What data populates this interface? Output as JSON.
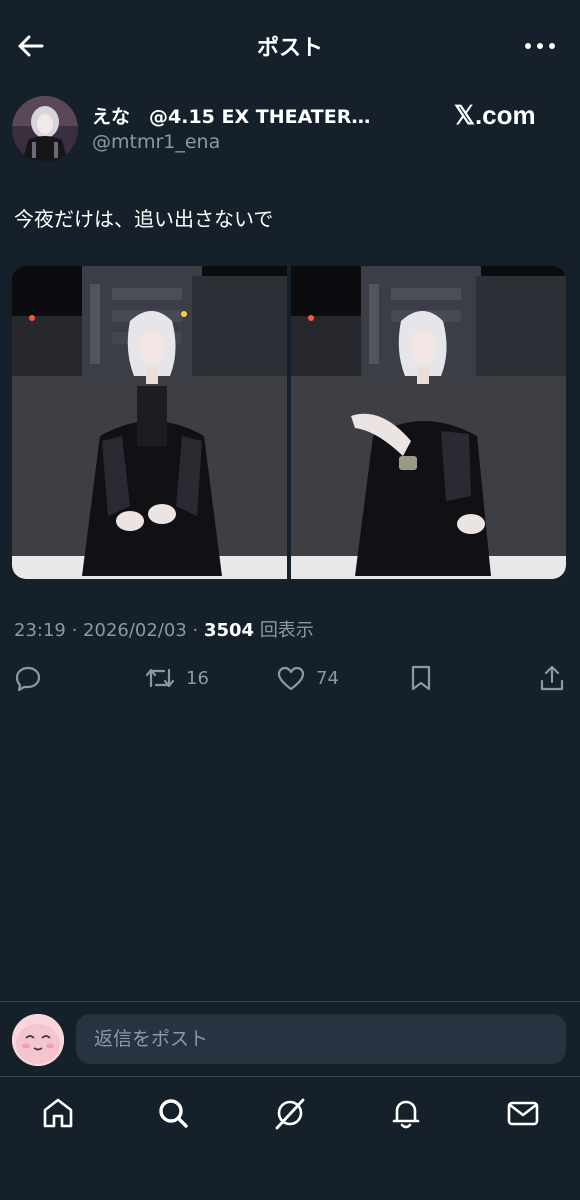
{
  "header": {
    "title": "ポスト",
    "back_icon": "arrow-left-icon",
    "more_icon": "more-horizontal-icon"
  },
  "author": {
    "name": "えな　@4.15 EX THEATER…",
    "handle": "@mtmr1_ena",
    "brand": "𝕏.com"
  },
  "post": {
    "text": "今夜だけは、追い出さないで"
  },
  "meta": {
    "time": "23:19",
    "date": "2026/02/03",
    "views": "3504",
    "views_label": "回表示"
  },
  "actions": {
    "reply_icon": "reply-icon",
    "repost_icon": "repost-icon",
    "repost_count": "16",
    "like_icon": "heart-icon",
    "like_count": "74",
    "bookmark_icon": "bookmark-icon",
    "share_icon": "share-icon"
  },
  "reply": {
    "placeholder": "返信をポスト"
  },
  "nav": [
    "home-icon",
    "search-icon",
    "grok-icon",
    "notifications-icon",
    "messages-icon"
  ],
  "colors": {
    "background": "#15202b",
    "text": "#e7e9ea",
    "secondary": "#8b98a5",
    "divider": "#38444d"
  }
}
